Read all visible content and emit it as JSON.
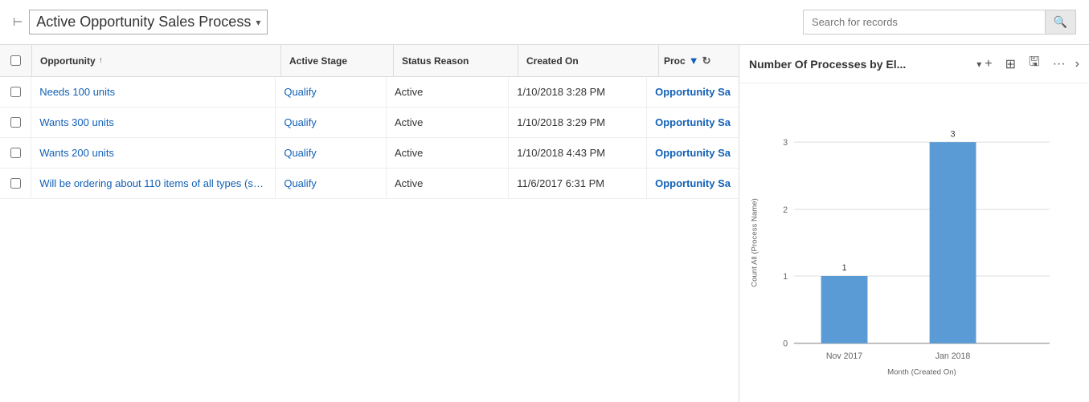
{
  "header": {
    "pin_icon": "📌",
    "title": "Active Opportunity Sales Process",
    "dropdown_arrow": "▾",
    "search_placeholder": "Search for records",
    "search_icon": "🔍"
  },
  "table": {
    "columns": [
      {
        "id": "opportunity",
        "label": "Opportunity",
        "sort": "↑"
      },
      {
        "id": "active_stage",
        "label": "Active Stage"
      },
      {
        "id": "status_reason",
        "label": "Status Reason"
      },
      {
        "id": "created_on",
        "label": "Created On"
      },
      {
        "id": "process",
        "label": "Proc"
      }
    ],
    "rows": [
      {
        "opportunity": "Needs 100 units",
        "active_stage": "Qualify",
        "status_reason": "Active",
        "created_on": "1/10/2018 3:28 PM",
        "process": "Opportunity Sa"
      },
      {
        "opportunity": "Wants 300 units",
        "active_stage": "Qualify",
        "status_reason": "Active",
        "created_on": "1/10/2018 3:29 PM",
        "process": "Opportunity Sa"
      },
      {
        "opportunity": "Wants 200 units",
        "active_stage": "Qualify",
        "status_reason": "Active",
        "created_on": "1/10/2018 4:43 PM",
        "process": "Opportunity Sa"
      },
      {
        "opportunity": "Will be ordering about 110 items of all types (sa...",
        "active_stage": "Qualify",
        "status_reason": "Active",
        "created_on": "11/6/2017 6:31 PM",
        "process": "Opportunity Sa"
      }
    ]
  },
  "chart": {
    "title": "Number Of Processes by El...",
    "dropdown_arrow": "▾",
    "add_icon": "+",
    "layout_icon": "⊞",
    "save_icon": "💾",
    "more_icon": "⋯",
    "expand_icon": "›",
    "y_axis_label": "Count All (Process Name)",
    "x_axis_label": "Month (Created On)",
    "bars": [
      {
        "label": "Nov 2017",
        "value": 1,
        "color": "#5b9bd5"
      },
      {
        "label": "Jan 2018",
        "value": 3,
        "color": "#5b9bd5"
      }
    ],
    "y_max": 3,
    "y_ticks": [
      0,
      1,
      2,
      3
    ]
  }
}
